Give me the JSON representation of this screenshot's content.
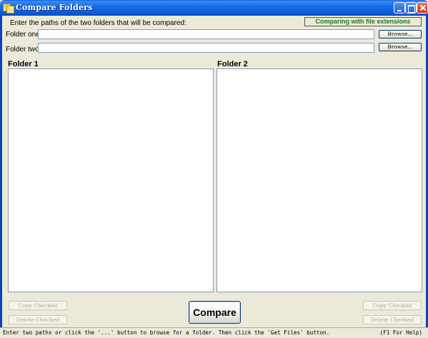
{
  "window": {
    "title": "Compare Folders",
    "title_icon": "folder-icon"
  },
  "instructions": "Enter the paths of the two folders that will be compared:",
  "extension_badge": "Comparing with file extensions",
  "folder_one": {
    "label": "Folder one:",
    "value": "",
    "browse_label": "Browse..."
  },
  "folder_two": {
    "label": "Folder two:",
    "value": "",
    "browse_label": "Browse..."
  },
  "pane_left": {
    "title": "Folder 1",
    "copy_label": "Copy Checked",
    "delete_label": "Delete Checked"
  },
  "pane_right": {
    "title": "Folder 2",
    "copy_label": "Copy Checked",
    "delete_label": "Delete Checked"
  },
  "compare_label": "Compare",
  "status": {
    "message": "Enter two paths or click the '...' button to browse for a folder. Then click the 'Get Files' button.",
    "help": "(F1 For Help)"
  },
  "colors": {
    "titlebar": "#0a55d4",
    "badge_text": "#1a7a1a",
    "window_bg": "#ece9d8"
  }
}
